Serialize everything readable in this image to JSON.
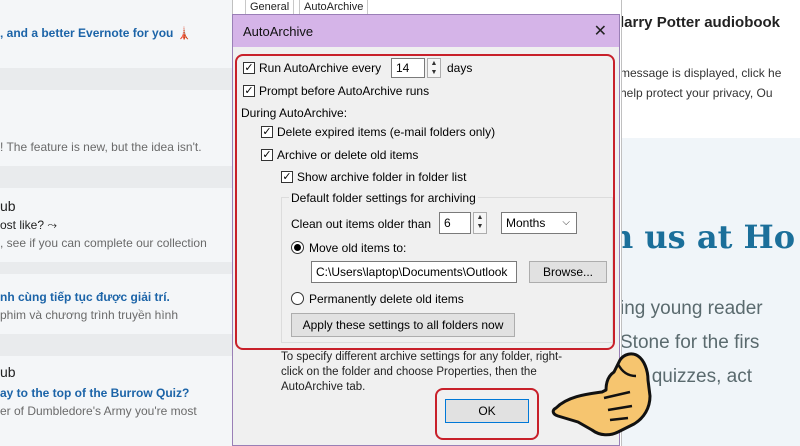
{
  "background_left": {
    "rows": [
      {
        "kind": "blue",
        "text": "‚ and a better Evernote for you 🗼"
      },
      {
        "kind": "gray",
        "text": "! The feature is new, but the idea isn't."
      },
      {
        "kind": "dark",
        "text": "ub"
      },
      {
        "kind": "gray-dark",
        "text": "ost like? ⤳"
      },
      {
        "kind": "gray",
        "text": ", see if you can complete our collection"
      },
      {
        "kind": "blue",
        "text": "nh cùng tiếp tục được giải trí."
      },
      {
        "kind": "gray",
        "text": "phim và chương trình truyền hình"
      },
      {
        "kind": "dark",
        "text": "ub"
      },
      {
        "kind": "blue",
        "text": "ay to the top of the Burrow Quiz?"
      },
      {
        "kind": "gray",
        "text": "er of Dumbledore's Army you're most"
      }
    ]
  },
  "background_right": {
    "subject": "larry Potter audiobook",
    "info_line1": "message is displayed, click he",
    "info_line2": "help protect your privacy, Ou",
    "banner_heading": "n us at Ho",
    "body_line1": "ing young reader",
    "body_line2": "Stone for the firs",
    "body_line3": "ted quizzes, act"
  },
  "options_dialog": {
    "tabs": [
      "General",
      "AutoArchive"
    ]
  },
  "dialog": {
    "title": "AutoArchive",
    "close_symbol": "✕",
    "run_every": {
      "checked": true,
      "label": "Run AutoArchive every",
      "value": "14",
      "unit": "days"
    },
    "prompt_before": {
      "checked": true,
      "label": "Prompt before AutoArchive runs"
    },
    "during_label": "During AutoArchive:",
    "delete_expired": {
      "checked": true,
      "label": "Delete expired items (e-mail folders only)"
    },
    "archive_old": {
      "checked": true,
      "label": "Archive or delete old items"
    },
    "show_folder": {
      "checked": true,
      "label": "Show archive folder in folder list"
    },
    "default_group_label": "Default folder settings for archiving",
    "clean_out": {
      "label": "Clean out items older than",
      "value": "6",
      "unit": "Months"
    },
    "move_old": {
      "selected": true,
      "label": "Move old items to:",
      "path": "C:\\Users\\laptop\\Documents\\Outlook",
      "browse_label": "Browse..."
    },
    "perm_delete": {
      "selected": false,
      "label": "Permanently delete old items"
    },
    "apply_all_label": "Apply these settings to all folders now",
    "hint": "To specify different archive settings for any folder, right-click on the folder and choose Properties, then the AutoArchive tab.",
    "ok_label": "OK"
  },
  "colors": {
    "titlebar": "#d5b4e8",
    "highlight": "#c8202a",
    "link_blue": "#1c64a8"
  }
}
